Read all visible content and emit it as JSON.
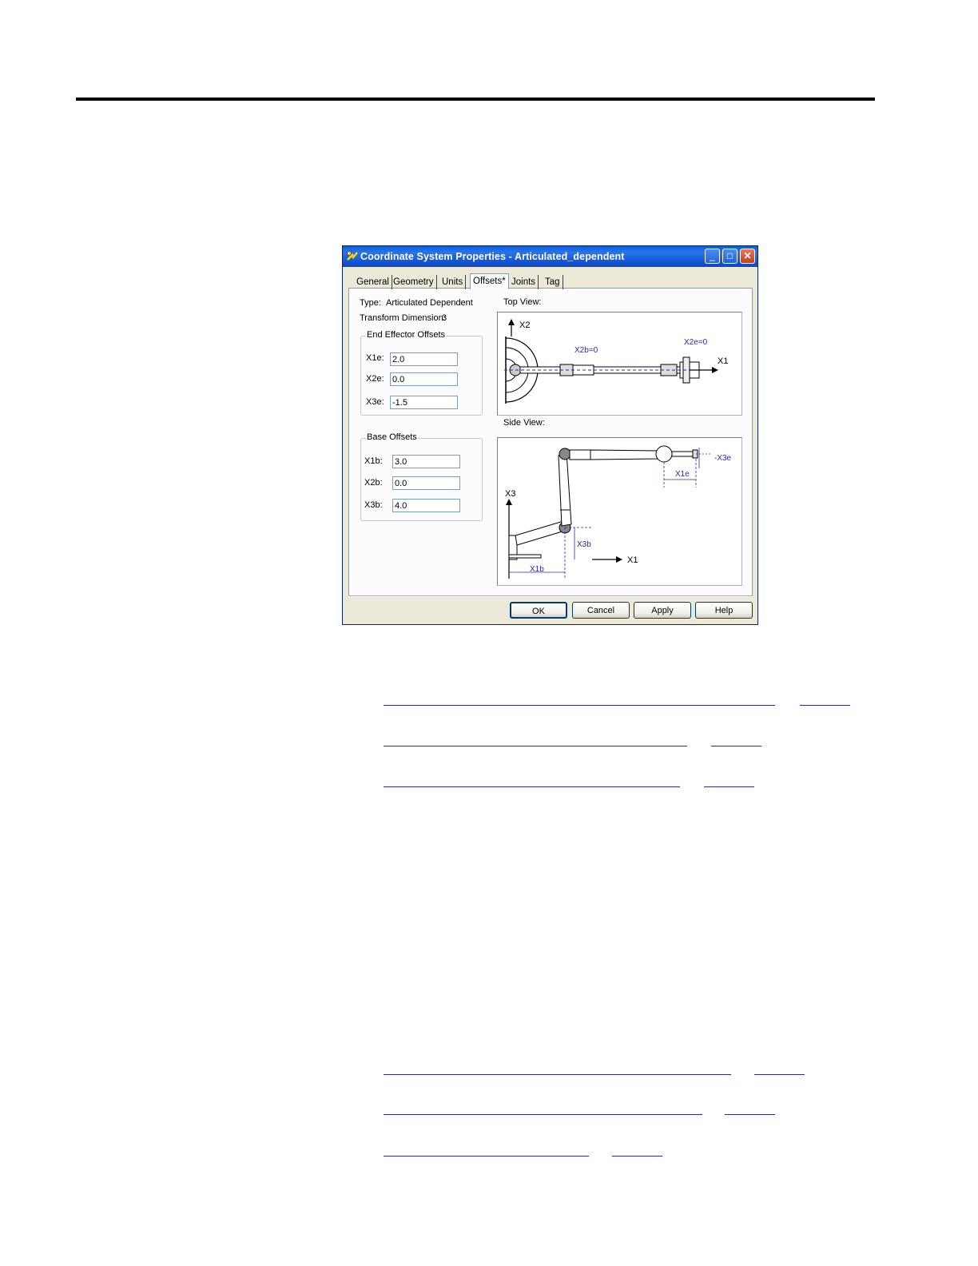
{
  "dialog": {
    "title": "Coordinate System Properties - Articulated_dependent",
    "tabs": [
      {
        "label": "General"
      },
      {
        "label": "Geometry"
      },
      {
        "label": "Units"
      },
      {
        "label": "Offsets*"
      },
      {
        "label": "Joints"
      },
      {
        "label": "Tag"
      }
    ],
    "active_tab": "Offsets*",
    "type_label": "Type:",
    "type_value": "Articulated Dependent",
    "transform_label": "Transform Dimension:",
    "transform_value": "3",
    "end_effector": {
      "title": "End Effector Offsets",
      "fields": [
        {
          "label": "X1e:",
          "value": "2.0"
        },
        {
          "label": "X2e:",
          "value": "0.0"
        },
        {
          "label": "X3e:",
          "value": "-1.5"
        }
      ]
    },
    "base": {
      "title": "Base Offsets",
      "fields": [
        {
          "label": "X1b:",
          "value": "3.0"
        },
        {
          "label": "X2b:",
          "value": "0.0"
        },
        {
          "label": "X3b:",
          "value": "4.0"
        }
      ]
    },
    "top_view": {
      "caption": "Top View:",
      "labels": {
        "x2": "X2",
        "x1": "X1",
        "x2b": "X2b=0",
        "x2e": "X2e=0"
      }
    },
    "side_view": {
      "caption": "Side View:",
      "labels": {
        "x3": "X3",
        "x1": "X1",
        "x1b": "X1b",
        "x3b": "X3b",
        "x1e": "X1e",
        "x3e": "-X3e"
      }
    },
    "buttons": {
      "ok": "OK",
      "cancel": "Cancel",
      "apply": "Apply",
      "help": "Help"
    },
    "colors": {
      "title_bar": "#0a5fdc",
      "dimension_blue": "#2b2b9a",
      "dialog_face": "#ece9d8"
    }
  }
}
